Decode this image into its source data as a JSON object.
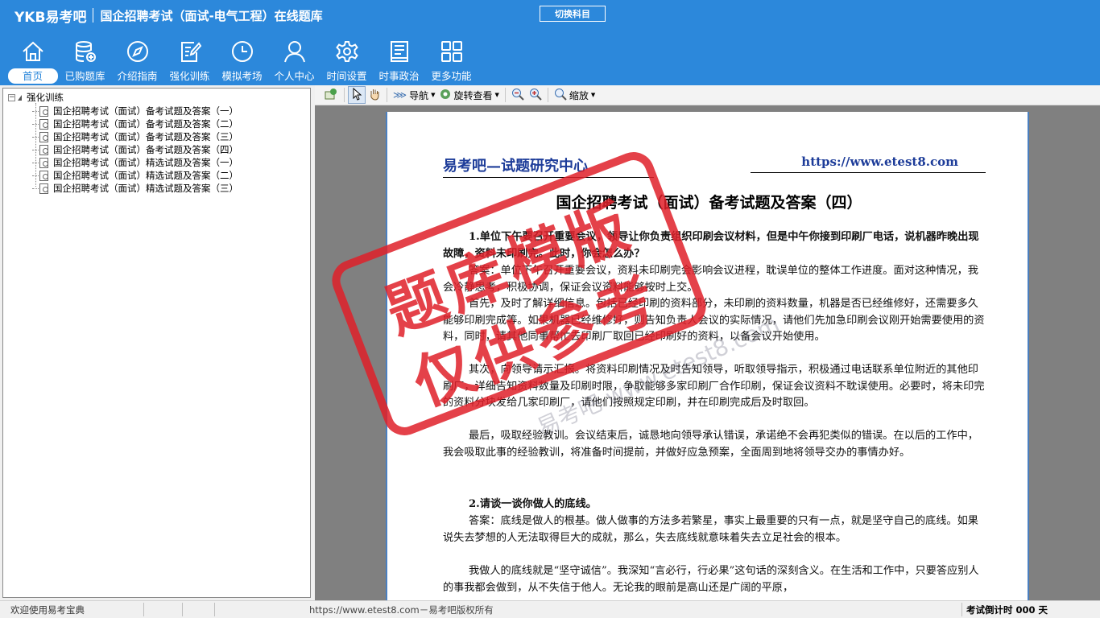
{
  "header": {
    "logo": "YKB易考吧",
    "title": "国企招聘考试（面试-电气工程）在线题库",
    "switch_label": "切换科目"
  },
  "nav": [
    {
      "label": "首页",
      "icon": "home-icon"
    },
    {
      "label": "已购题库",
      "icon": "database-icon"
    },
    {
      "label": "介绍指南",
      "icon": "compass-icon"
    },
    {
      "label": "强化训练",
      "icon": "edit-icon"
    },
    {
      "label": "模拟考场",
      "icon": "clock-icon"
    },
    {
      "label": "个人中心",
      "icon": "user-icon"
    },
    {
      "label": "时间设置",
      "icon": "gear-icon"
    },
    {
      "label": "时事政治",
      "icon": "news-icon"
    },
    {
      "label": "更多功能",
      "icon": "grid-icon"
    }
  ],
  "tree": {
    "root": "强化训练",
    "items": [
      "国企招聘考试（面试）备考试题及答案（一）",
      "国企招聘考试（面试）备考试题及答案（二）",
      "国企招聘考试（面试）备考试题及答案（三）",
      "国企招聘考试（面试）备考试题及答案（四）",
      "国企招聘考试（面试）精选试题及答案（一）",
      "国企招聘考试（面试）精选试题及答案（二）",
      "国企招聘考试（面试）精选试题及答案（三）"
    ]
  },
  "toolbar": {
    "navigate": "导航",
    "rotate": "旋转查看",
    "zoom": "缩放"
  },
  "document": {
    "header_left": "易考吧—试题研究中心",
    "header_right": "https://www.etest8.com",
    "title": "国企招聘考试（面试）备考试题及答案（四）",
    "q1": "1.单位下午要召开重要会议，领导让你负责组织印刷会议材料，但是中午你接到印刷厂电话，说机器昨晚出现故障，资料未印刷完。此时，你会怎么办？",
    "p1": "答案：单位下午召开重要会议，资料未印刷完会影响会议进程，耽误单位的整体工作进度。面对这种情况，我会冷静思考，积极协调，保证会议资料能够按时上交。",
    "p2": "首先，及时了解详细信息。包括已经印刷的资料部分，未印刷的资料数量，机器是否已经维修好，还需要多久能够印刷完成等。如果机器已经维修好，则告知负责人会议的实际情况，请他们先加急印刷会议刚开始需要使用的资料，同时，请其他同事帮忙去印刷厂取回已经印刷好的资料，以备会议开始使用。",
    "p3": "其次，向领导请示汇报。将资料印刷情况及时告知领导，听取领导指示，积极通过电话联系单位附近的其他印刷厂，详细告知资料数量及印刷时限，争取能够多家印刷厂合作印刷，保证会议资料不耽误使用。必要时，将未印完的资料分块发给几家印刷厂，请他们按照规定印刷，并在印刷完成后及时取回。",
    "p4": "最后，吸取经验教训。会议结束后，诚恳地向领导承认错误，承诺绝不会再犯类似的错误。在以后的工作中，我会吸取此事的经验教训，将准备时间提前，并做好应急预案，全面周到地将领导交办的事情办好。",
    "q2": "2.请谈一谈你做人的底线。",
    "p5": "答案：底线是做人的根基。做人做事的方法多若繁星，事实上最重要的只有一点，就是坚守自己的底线。如果说失去梦想的人无法取得巨大的成就，那么，失去底线就意味着失去立足社会的根本。",
    "p6": "我做人的底线就是“坚守诚信”。我深知“言必行，行必果”这句话的深刻含义。在生活和工作中，只要答应别人的事我都会做到，从不失信于他人。无论我的眼前是高山还是广阔的平原，",
    "stamp_line1": "题库模版",
    "stamp_line2": "仅供参考",
    "watermark": "易考吧 www.etest8.com"
  },
  "status": {
    "welcome": "欢迎使用易考宝典",
    "copyright": "https://www.etest8.com－易考吧版权所有",
    "countdown": "考试倒计时 000 天"
  },
  "colors": {
    "header_bg": "#2c88db",
    "stamp": "#e0202a",
    "doc_header": "#1d3c99"
  }
}
